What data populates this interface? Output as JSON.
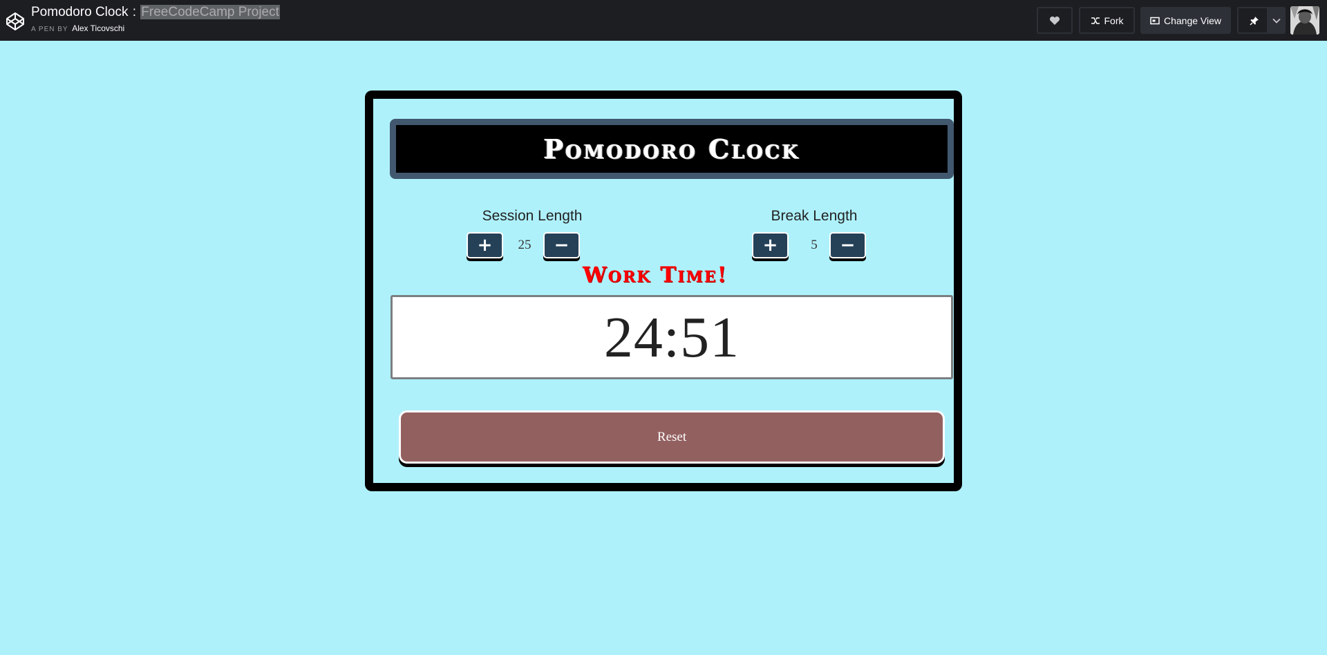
{
  "header": {
    "title_main": "Pomodoro Clock",
    "title_separator": ":",
    "title_highlight": "FreeCodeCamp Project",
    "byline_prefix": "A PEN BY",
    "author": "Alex Ticovschi",
    "fork_label": "Fork",
    "change_view_label": "Change View"
  },
  "app": {
    "title": "Pomodoro Clock",
    "session": {
      "label": "Session Length",
      "value": "25",
      "plus": "+",
      "minus": "−"
    },
    "break": {
      "label": "Break Length",
      "value": "5",
      "plus": "+",
      "minus": "−"
    },
    "mode": "Work Time!",
    "time": "24:51",
    "reset_label": "Reset"
  },
  "colors": {
    "page_bg": "#aef1fb",
    "topbar_bg": "#1d1e22",
    "title_box_border": "#41586f",
    "control_button": "#244158",
    "mode_text": "#ff0000",
    "reset_button": "#936060"
  },
  "icons": {
    "logo": "codepen-logo-icon",
    "like": "heart-icon",
    "fork": "fork-icon",
    "view": "change-view-icon",
    "pin": "pin-icon",
    "dropdown": "chevron-down-icon"
  }
}
